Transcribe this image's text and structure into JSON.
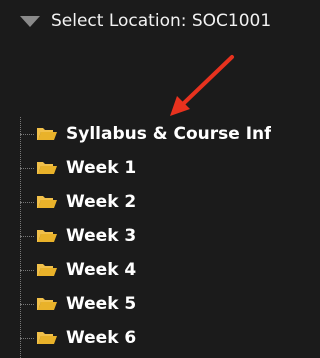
{
  "header": {
    "label": "Select Location: SOC1001"
  },
  "tree": {
    "items": [
      {
        "label": "Syllabus & Course Info"
      },
      {
        "label": "Week 1"
      },
      {
        "label": "Week 2"
      },
      {
        "label": "Week 3"
      },
      {
        "label": "Week 4"
      },
      {
        "label": "Week 5"
      },
      {
        "label": "Week 6"
      }
    ]
  },
  "colors": {
    "background": "#1b1b1b",
    "arrow": "#e8321e",
    "folder": "#e9b22a",
    "text": "#ffffff"
  },
  "icons": {
    "caret": "caret-down-icon",
    "folder": "folder-open-icon"
  }
}
